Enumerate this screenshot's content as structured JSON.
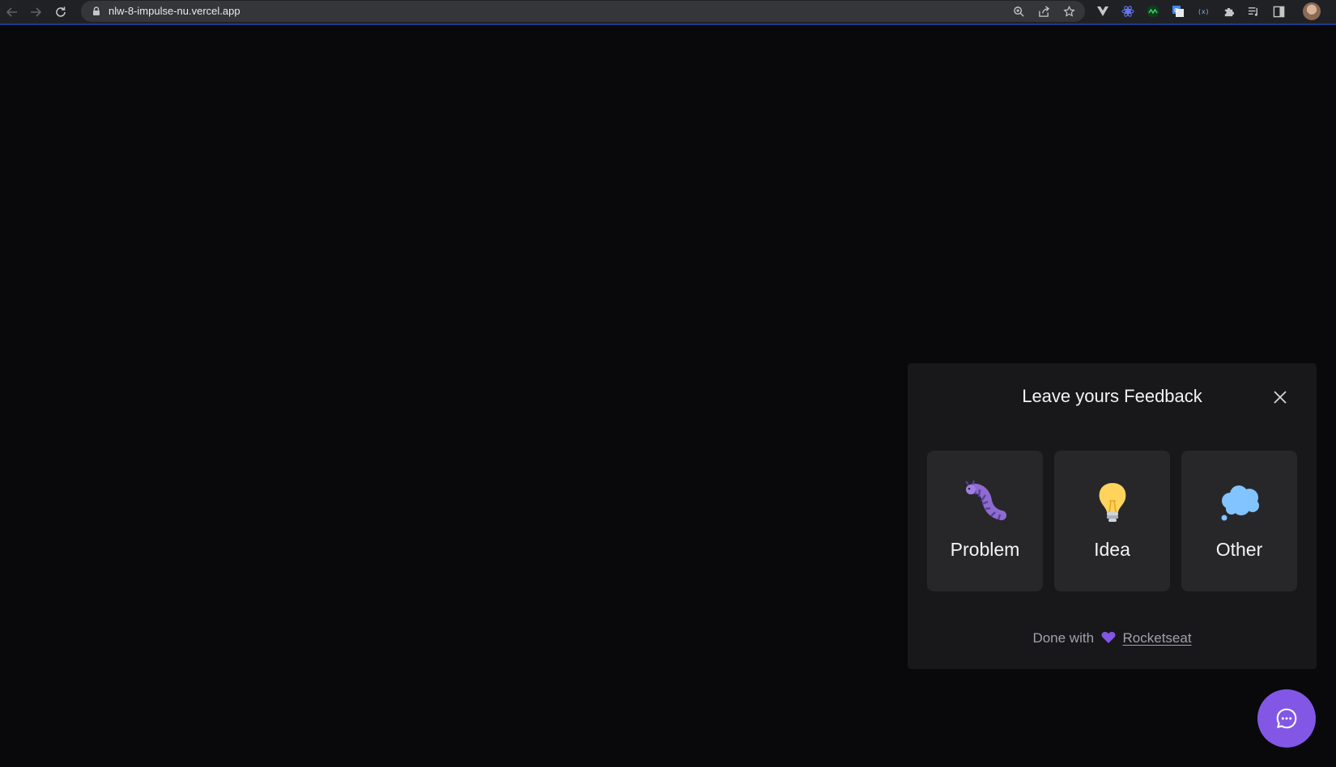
{
  "browser": {
    "url": "nlw-8-impulse-nu.vercel.app",
    "icons": [
      "back-arrow-icon",
      "forward-arrow-icon",
      "reload-icon",
      "lock-icon",
      "zoom-icon",
      "share-icon",
      "bookmark-star-icon",
      "extension-icons",
      "puzzle-icon",
      "reading-list-icon",
      "side-panel-icon",
      "profile-avatar"
    ]
  },
  "feedback": {
    "title": "Leave yours Feedback",
    "options": [
      {
        "label": "Problem",
        "icon": "bug-emoji-icon"
      },
      {
        "label": "Idea",
        "icon": "lightbulb-emoji-icon"
      },
      {
        "label": "Other",
        "icon": "thought-balloon-emoji-icon"
      }
    ],
    "footer_prefix": "Done with",
    "footer_link": "Rocketseat"
  },
  "colors": {
    "background": "#09090b",
    "panel": "#18181b",
    "card": "#27272a",
    "brand": "#8257e5"
  }
}
